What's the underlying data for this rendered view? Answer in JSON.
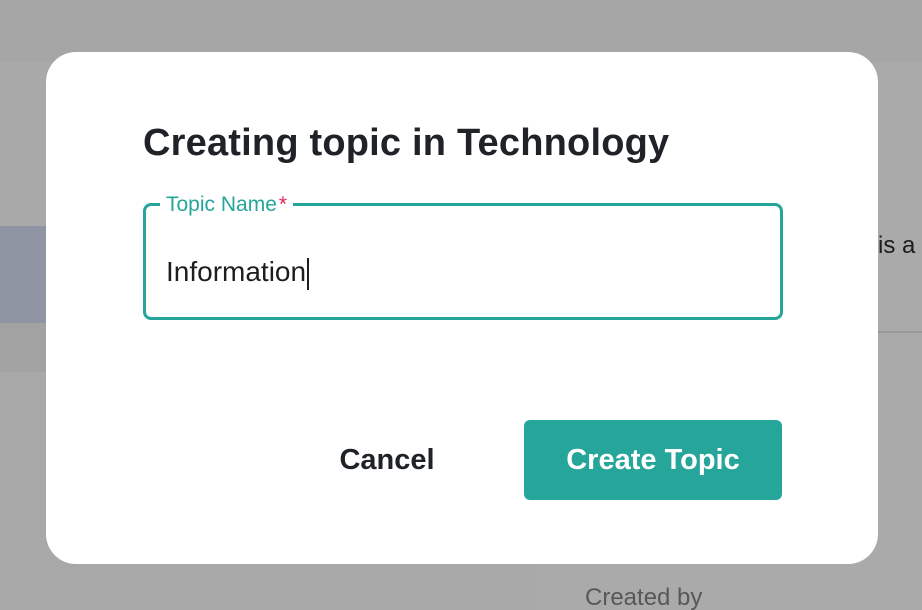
{
  "background": {
    "side_panel_text_fragment": "is a",
    "created_by_label": "Created by"
  },
  "dialog": {
    "title": "Creating topic in Technology",
    "field": {
      "label": "Topic Name",
      "required_marker": "*",
      "value": "Information",
      "has_focus": true
    },
    "cancel_label": "Cancel",
    "create_label": "Create Topic"
  },
  "colors": {
    "accent": "#26a69a",
    "required_marker": "#e02456",
    "title_text": "#1f2328",
    "overlay_background": "#a9a9a9",
    "dialog_background": "#ffffff"
  }
}
